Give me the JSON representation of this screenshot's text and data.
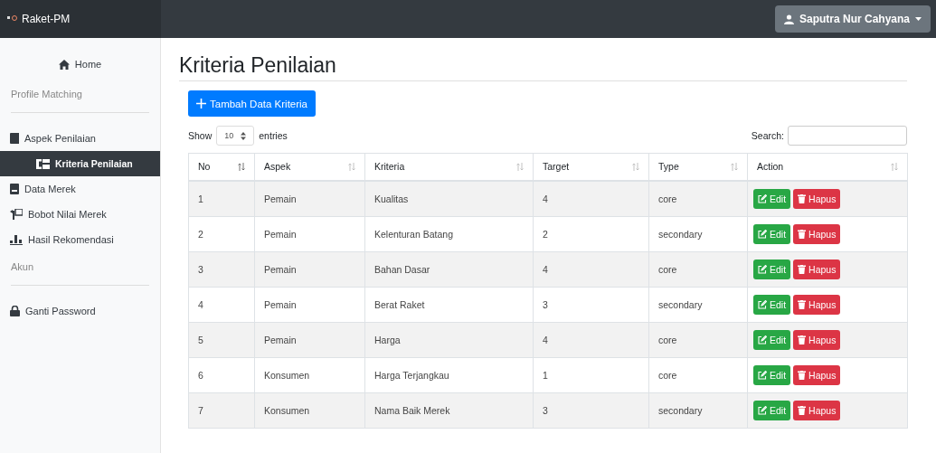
{
  "navbar": {
    "brand": "Raket-PM",
    "user": "Saputra Nur Cahyana"
  },
  "sidebar": {
    "items": [
      {
        "kind": "link",
        "label": "Home",
        "selected": false
      },
      {
        "kind": "heading",
        "label": "Profile Matching"
      },
      {
        "kind": "link",
        "label": "Aspek Penilaian",
        "selected": false,
        "children": [
          {
            "kind": "link",
            "label": "Kriteria Penilaian",
            "selected": true
          }
        ]
      },
      {
        "kind": "link",
        "label": "Data Merek",
        "selected": false
      },
      {
        "kind": "link",
        "label": "Bobot Nilai Merek",
        "selected": false
      },
      {
        "kind": "link",
        "label": "Hasil Rekomendasi",
        "selected": false
      },
      {
        "kind": "heading",
        "label": "Akun"
      },
      {
        "kind": "link",
        "label": "Ganti Password",
        "selected": false
      }
    ]
  },
  "page": {
    "title": "Kriteria Penilaian",
    "add_button": "Tambah Data Kriteria"
  },
  "table_controls": {
    "show_label": "Show",
    "page_size": "10",
    "entries_label": "entries",
    "search_label": "Search:"
  },
  "table": {
    "columns": [
      "No",
      "Aspek",
      "Kriteria",
      "Target",
      "Type",
      "Action"
    ],
    "rows": [
      {
        "cells": [
          "1",
          "Pemain",
          "Kualitas",
          "4",
          "core"
        ],
        "actions": [
          "Edit",
          "Hapus"
        ]
      },
      {
        "cells": [
          "2",
          "Pemain",
          "Kelenturan Batang",
          "2",
          "secondary"
        ],
        "actions": [
          "Edit",
          "Hapus"
        ]
      },
      {
        "cells": [
          "3",
          "Pemain",
          "Bahan Dasar",
          "4",
          "core"
        ],
        "actions": [
          "Edit",
          "Hapus"
        ]
      },
      {
        "cells": [
          "4",
          "Pemain",
          "Berat Raket",
          "3",
          "secondary"
        ],
        "actions": [
          "Edit",
          "Hapus"
        ]
      },
      {
        "cells": [
          "5",
          "Pemain",
          "Harga",
          "4",
          "core"
        ],
        "actions": [
          "Edit",
          "Hapus"
        ]
      },
      {
        "cells": [
          "6",
          "Konsumen",
          "Harga Terjangkau",
          "1",
          "core"
        ],
        "actions": [
          "Edit",
          "Hapus"
        ]
      },
      {
        "cells": [
          "7",
          "Konsumen",
          "Nama Baik Merek",
          "3",
          "secondary"
        ],
        "actions": [
          "Edit",
          "Hapus"
        ]
      }
    ]
  }
}
